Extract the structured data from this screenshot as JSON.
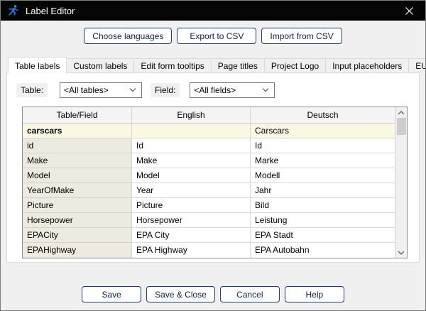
{
  "window": {
    "title": "Label Editor"
  },
  "toolbar": {
    "choose_languages": "Choose languages",
    "export_csv": "Export to CSV",
    "import_csv": "Import from CSV"
  },
  "tabs": [
    {
      "label": "Table labels",
      "active": true
    },
    {
      "label": "Custom labels",
      "active": false
    },
    {
      "label": "Edit form tooltips",
      "active": false
    },
    {
      "label": "Page titles",
      "active": false
    },
    {
      "label": "Project Logo",
      "active": false
    },
    {
      "label": "Input placeholders",
      "active": false
    },
    {
      "label": "EU cookie banner",
      "active": false
    }
  ],
  "filters": {
    "table_label": "Table:",
    "table_value": "<All tables>",
    "field_label": "Field:",
    "field_value": "<All fields>"
  },
  "table": {
    "columns": [
      "Table/Field",
      "English",
      "Deutsch"
    ],
    "rows": [
      {
        "field": "carscars",
        "english": "",
        "deutsch": "Carscars",
        "highlighted": true
      },
      {
        "field": "id",
        "english": "Id",
        "deutsch": "Id",
        "highlighted": false
      },
      {
        "field": "Make",
        "english": "Make",
        "deutsch": "Marke",
        "highlighted": false
      },
      {
        "field": "Model",
        "english": "Model",
        "deutsch": "Modell",
        "highlighted": false
      },
      {
        "field": "YearOfMake",
        "english": "Year",
        "deutsch": "Jahr",
        "highlighted": false
      },
      {
        "field": "Picture",
        "english": "Picture",
        "deutsch": "Bild",
        "highlighted": false
      },
      {
        "field": "Horsepower",
        "english": "Horsepower",
        "deutsch": "Leistung",
        "highlighted": false
      },
      {
        "field": "EPACity",
        "english": "EPA City",
        "deutsch": "EPA Stadt",
        "highlighted": false
      },
      {
        "field": "EPAHighway",
        "english": "EPA Highway",
        "deutsch": "EPA Autobahn",
        "highlighted": false
      }
    ]
  },
  "footer": {
    "save": "Save",
    "save_close": "Save & Close",
    "cancel": "Cancel",
    "help": "Help"
  },
  "colors": {
    "titlebar_bg": "#050505",
    "button_border": "#1d3e6e",
    "button_text": "#0d2246",
    "highlight_row_bg": "#fbf8e2",
    "field_column_bg": "#edeadf",
    "dialog_bg": "#f0f0f0",
    "panel_bg": "#ffffff",
    "app_icon_blue": "#2f6fd0"
  }
}
